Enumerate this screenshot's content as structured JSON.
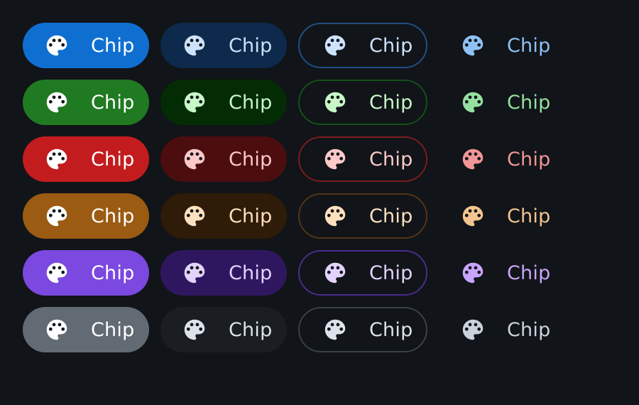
{
  "chip_label": "Chip",
  "icon": "palette-icon",
  "variants": [
    "filled",
    "tonal",
    "outlined",
    "plain"
  ],
  "rows": [
    {
      "color": "primary",
      "filled": {
        "label": "Chip",
        "bg": "#0f6fd1",
        "fg": "#ffffff"
      },
      "tonal": {
        "label": "Chip",
        "bg": "#0d2a4c",
        "fg": "#cde3fb"
      },
      "outlined": {
        "label": "Chip",
        "border": "#1f4f86",
        "fg": "#cde3fb"
      },
      "plain": {
        "label": "Chip",
        "fg": "#8fc1f5"
      }
    },
    {
      "color": "success",
      "filled": {
        "label": "Chip",
        "bg": "#1f7a21",
        "fg": "#ffffff"
      },
      "tonal": {
        "label": "Chip",
        "bg": "#042c04",
        "fg": "#c8f7c8"
      },
      "outlined": {
        "label": "Chip",
        "border": "#14501a",
        "fg": "#c8f7c8"
      },
      "plain": {
        "label": "Chip",
        "fg": "#95e0a0"
      }
    },
    {
      "color": "danger",
      "filled": {
        "label": "Chip",
        "bg": "#c31c1f",
        "fg": "#ffffff"
      },
      "tonal": {
        "label": "Chip",
        "bg": "#4b0d0e",
        "fg": "#fdc9c9"
      },
      "outlined": {
        "label": "Chip",
        "border": "#7a1d1e",
        "fg": "#fdc9c9"
      },
      "plain": {
        "label": "Chip",
        "fg": "#f19696"
      }
    },
    {
      "color": "warning",
      "filled": {
        "label": "Chip",
        "bg": "#9b5b12",
        "fg": "#ffffff"
      },
      "tonal": {
        "label": "Chip",
        "bg": "#2e1b08",
        "fg": "#fde0bf"
      },
      "outlined": {
        "label": "Chip",
        "border": "#52351a",
        "fg": "#fde0bf"
      },
      "plain": {
        "label": "Chip",
        "fg": "#f3c48f"
      }
    },
    {
      "color": "violet",
      "filled": {
        "label": "Chip",
        "bg": "#7b48e0",
        "fg": "#ffffff"
      },
      "tonal": {
        "label": "Chip",
        "bg": "#2f1760",
        "fg": "#e3d3fd"
      },
      "outlined": {
        "label": "Chip",
        "border": "#4a2c8e",
        "fg": "#e3d3fd"
      },
      "plain": {
        "label": "Chip",
        "fg": "#c9a5fb"
      }
    },
    {
      "color": "neutral",
      "filled": {
        "label": "Chip",
        "bg": "#626a73",
        "fg": "#ffffff"
      },
      "tonal": {
        "label": "Chip",
        "bg": "#1a1d21",
        "fg": "#dce3ea"
      },
      "outlined": {
        "label": "Chip",
        "border": "#3a4048",
        "fg": "#dce3ea"
      },
      "plain": {
        "label": "Chip",
        "fg": "#cad3dd"
      }
    }
  ]
}
